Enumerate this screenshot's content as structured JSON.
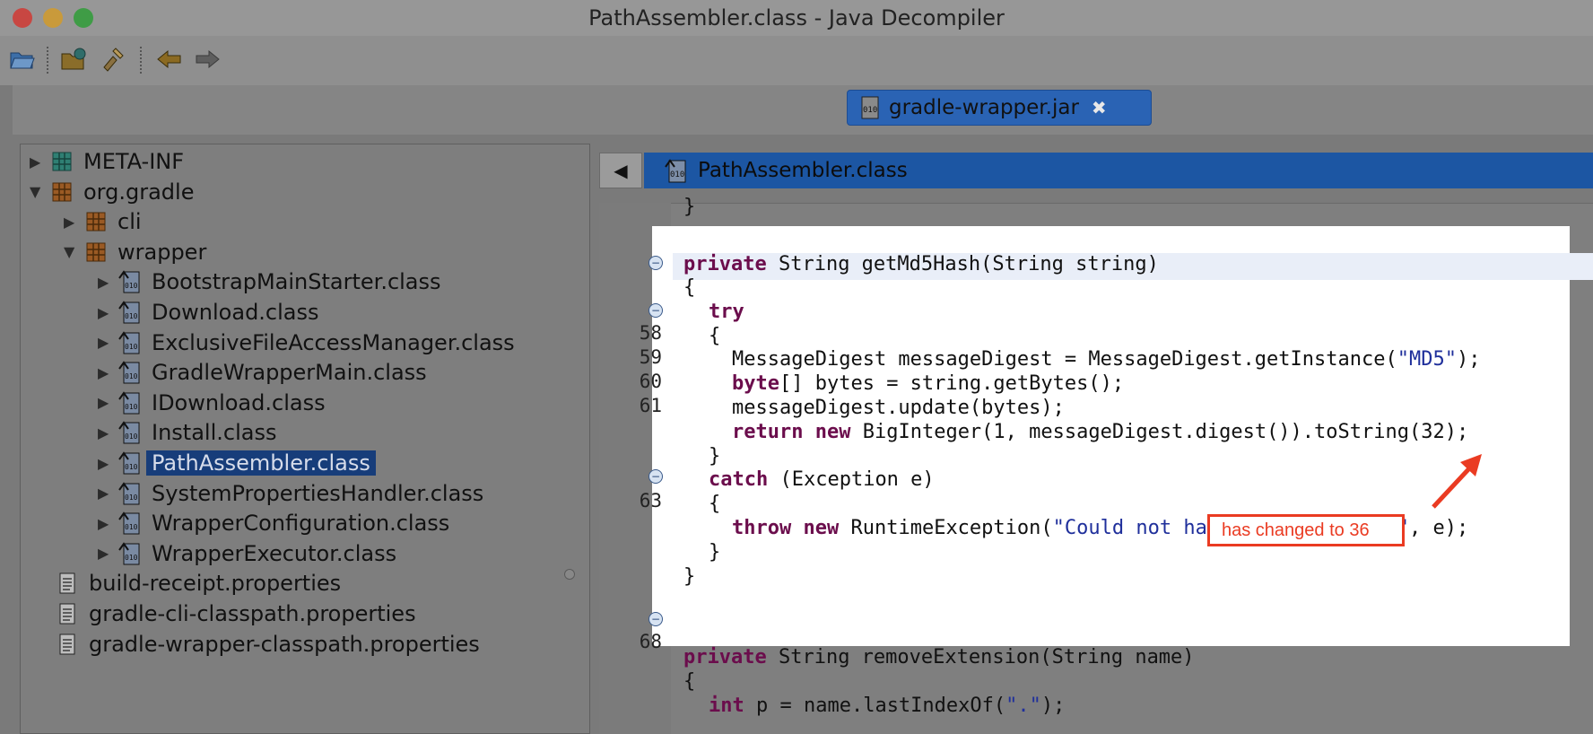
{
  "window": {
    "title": "PathAssembler.class - Java Decompiler",
    "colors": {
      "close": "#fc5753",
      "minimize": "#fdbc40",
      "zoom": "#33c748"
    }
  },
  "toolbar": {
    "buttons": [
      "open-file-icon",
      "open-type-icon",
      "search-icon",
      "back-icon",
      "forward-icon"
    ]
  },
  "file_tab": {
    "label": "gradle-wrapper.jar",
    "icon": "binary-file-icon",
    "close_icon": "close-icon"
  },
  "tree": {
    "items": [
      {
        "label": "META-INF",
        "kind": "folder-icon",
        "arrow": "▶"
      },
      {
        "label": "org.gradle",
        "kind": "package-icon",
        "arrow": "▼"
      },
      {
        "label": "cli",
        "kind": "package-icon",
        "arrow": "▶"
      },
      {
        "label": "wrapper",
        "kind": "package-icon",
        "arrow": "▼"
      },
      {
        "label": "BootstrapMainStarter.class",
        "kind": "class-file-icon",
        "arrow": "▶"
      },
      {
        "label": "Download.class",
        "kind": "class-file-icon",
        "arrow": "▶"
      },
      {
        "label": "ExclusiveFileAccessManager.class",
        "kind": "class-file-icon",
        "arrow": "▶"
      },
      {
        "label": "GradleWrapperMain.class",
        "kind": "class-file-icon",
        "arrow": "▶"
      },
      {
        "label": "IDownload.class",
        "kind": "class-file-icon",
        "arrow": "▶"
      },
      {
        "label": "Install.class",
        "kind": "class-file-icon",
        "arrow": "▶"
      },
      {
        "label": "PathAssembler.class",
        "kind": "class-file-icon",
        "arrow": "▶",
        "selected": true
      },
      {
        "label": "SystemPropertiesHandler.class",
        "kind": "class-file-icon",
        "arrow": "▶"
      },
      {
        "label": "WrapperConfiguration.class",
        "kind": "class-file-icon",
        "arrow": "▶"
      },
      {
        "label": "WrapperExecutor.class",
        "kind": "class-file-icon",
        "arrow": "▶"
      },
      {
        "label": "build-receipt.properties",
        "kind": "text-file-icon",
        "arrow": ""
      },
      {
        "label": "gradle-cli-classpath.properties",
        "kind": "text-file-icon",
        "arrow": ""
      },
      {
        "label": "gradle-wrapper-classpath.properties",
        "kind": "text-file-icon",
        "arrow": ""
      }
    ]
  },
  "editor": {
    "back_label": "◀",
    "tab_label": "PathAssembler.class",
    "line_numbers": [
      "58",
      "59",
      "60",
      "61",
      "63",
      "68"
    ],
    "code": {
      "l0": "}",
      "l1_kw": "private",
      "l1_rest": " String getMd5Hash(String string)",
      "l2": "{",
      "l3_kw": "try",
      "l4": "{",
      "l5_a": "MessageDigest messageDigest = MessageDigest.getInstance(",
      "l5_str": "\"MD5\"",
      "l5_b": ");",
      "l6_kw": "byte",
      "l6_rest": "[] bytes = string.getBytes();",
      "l7": "messageDigest.update(bytes);",
      "l8_kw1": "return",
      "l8_kw2": "new",
      "l8_rest": " BigInteger(1, messageDigest.digest()).toString(32);",
      "l9": "}",
      "l10_kw": "catch",
      "l10_rest": " (Exception e)",
      "l11": "{",
      "l12_kw1": "throw",
      "l12_kw2": "new",
      "l12_a": " RuntimeException(",
      "l12_str": "\"Could not hash input string.\"",
      "l12_b": ", e);",
      "l13": "}",
      "l14": "}",
      "l15_kw": "private",
      "l15_rest": " String removeExtension(String name)",
      "l16": "{",
      "l17_kw": "int",
      "l17_a": " p = name.lastIndexOf(",
      "l17_str": "\".\"",
      "l17_b": ");"
    }
  },
  "annotation": {
    "text": "has changed to 36",
    "color": "#ea3b22"
  }
}
